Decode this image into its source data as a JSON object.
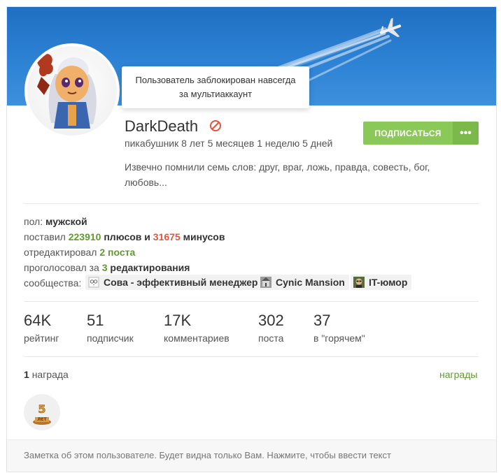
{
  "tooltip": {
    "line1": "Пользователь заблокирован навсегда",
    "line2": "за мультиаккаунт"
  },
  "profile": {
    "name": "DarkDeath",
    "tenure": "пикабушник 8 лет 5 месяцев 1 неделю 5 дней",
    "about": "Извечно помнили семь слов: друг, враг, ложь, правда, совесть, бог, любовь...",
    "ban_icon": "ban-icon"
  },
  "actions": {
    "subscribe_label": "ПОДПИСАТЬСЯ",
    "more_label": "•••"
  },
  "info": {
    "gender_label": "пол:",
    "gender_value": "мужской",
    "votes_prefix": "поставил",
    "plus_count": "223910",
    "plus_word": "плюсов и",
    "minus_count": "31675",
    "minus_word": "минусов",
    "edited_prefix": "отредактировал",
    "edited_value": "2 поста",
    "voted_prefix": "проголосовал за",
    "voted_count": "3",
    "voted_word": "редактирования",
    "communities_label": "сообщества:",
    "communities": [
      {
        "name": "Сова - эффективный менеджер",
        "icon": "owl-icon"
      },
      {
        "name": "Cynic Mansion",
        "icon": "mansion-icon"
      },
      {
        "name": "IT-юмор",
        "icon": "it-humor-icon"
      }
    ]
  },
  "stats": [
    {
      "value": "64K",
      "label": "рейтинг"
    },
    {
      "value": "51",
      "label": "подписчик"
    },
    {
      "value": "17K",
      "label": "комментариев"
    },
    {
      "value": "302",
      "label": "поста"
    },
    {
      "value": "37",
      "label": "в \"горячем\""
    }
  ],
  "awards": {
    "count": "1",
    "count_word": "награда",
    "link": "награды",
    "badge_text": "5",
    "badge_sub": "ЛЕТ"
  },
  "note": {
    "placeholder": "Заметка об этом пользователе. Будет видна только Вам. Нажмите, чтобы ввести текст"
  },
  "colors": {
    "banner": "#2d82d4",
    "accent_green": "#8ac858",
    "link_green": "#5f9b2f",
    "minus_red": "#e4533c"
  }
}
